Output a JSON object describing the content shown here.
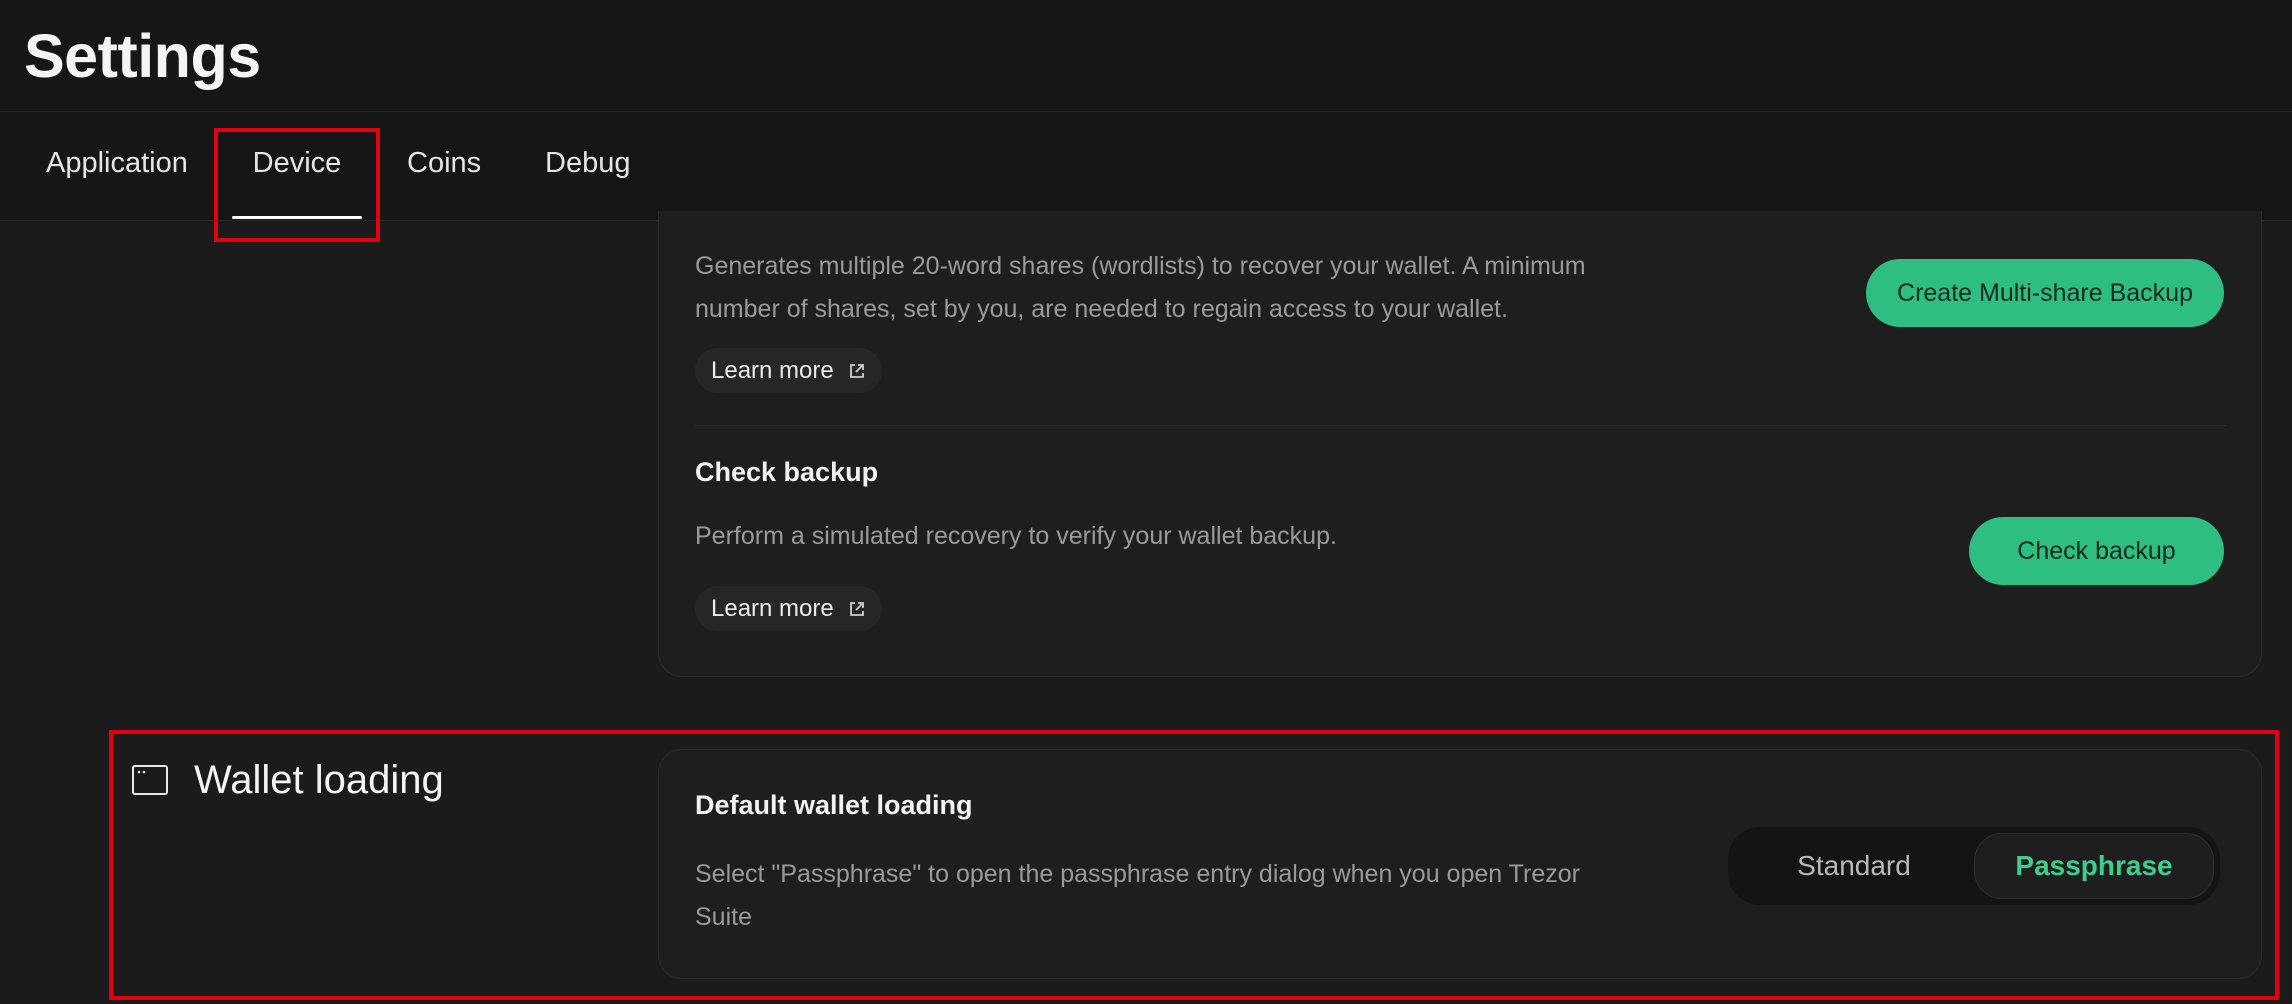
{
  "header": {
    "title": "Settings"
  },
  "tabs": [
    {
      "label": "Application"
    },
    {
      "label": "Device",
      "active": true
    },
    {
      "label": "Coins"
    },
    {
      "label": "Debug"
    }
  ],
  "backup": {
    "multishare": {
      "description_line1": "Generates multiple 20-word shares (wordlists) to recover your wallet. A minimum",
      "description_line2": "number of shares, set by you, are needed to regain access to your wallet.",
      "learn_more": "Learn more",
      "button": "Create Multi-share Backup"
    },
    "check": {
      "title": "Check backup",
      "description": "Perform a simulated recovery to verify your wallet backup.",
      "learn_more": "Learn more",
      "button": "Check backup"
    }
  },
  "wallet_loading": {
    "section_title": "Wallet loading",
    "row_title": "Default wallet loading",
    "description_line1": "Select \"Passphrase\" to open the passphrase entry dialog when you open Trezor",
    "description_line2": "Suite",
    "options": [
      "Standard",
      "Passphrase"
    ],
    "selected": "Passphrase"
  },
  "colors": {
    "accent_green": "#2fbe81",
    "highlight_red": "#e3000f",
    "background": "#161616"
  }
}
